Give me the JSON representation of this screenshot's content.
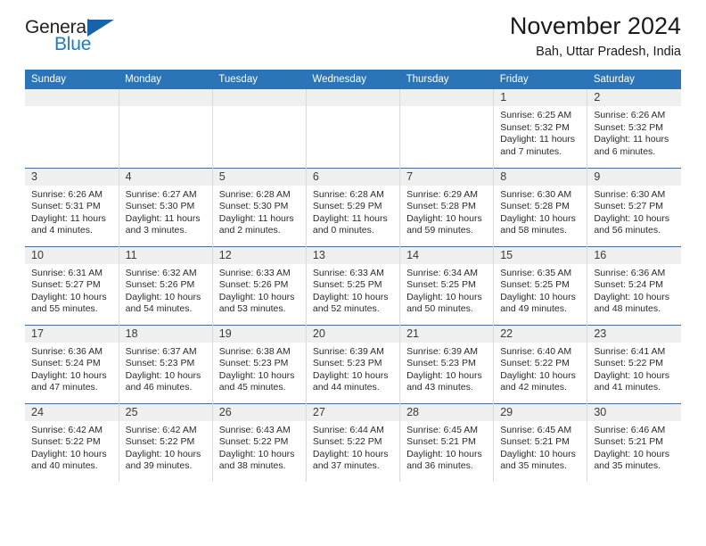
{
  "logo": {
    "word_top": "General",
    "word_bottom": "Blue",
    "triangle_color": "#1763ab",
    "blue_text_color": "#1f7ac4"
  },
  "header": {
    "title": "November 2024",
    "subtitle": "Bah, Uttar Pradesh, India",
    "accent_color": "#2b74b8"
  },
  "calendar": {
    "weekdays": [
      "Sunday",
      "Monday",
      "Tuesday",
      "Wednesday",
      "Thursday",
      "Friday",
      "Saturday"
    ],
    "weeks": [
      [
        {
          "day": "",
          "sunrise": "",
          "sunset": "",
          "daylight1": "",
          "daylight2": ""
        },
        {
          "day": "",
          "sunrise": "",
          "sunset": "",
          "daylight1": "",
          "daylight2": ""
        },
        {
          "day": "",
          "sunrise": "",
          "sunset": "",
          "daylight1": "",
          "daylight2": ""
        },
        {
          "day": "",
          "sunrise": "",
          "sunset": "",
          "daylight1": "",
          "daylight2": ""
        },
        {
          "day": "",
          "sunrise": "",
          "sunset": "",
          "daylight1": "",
          "daylight2": ""
        },
        {
          "day": "1",
          "sunrise": "Sunrise: 6:25 AM",
          "sunset": "Sunset: 5:32 PM",
          "daylight1": "Daylight: 11 hours",
          "daylight2": "and 7 minutes."
        },
        {
          "day": "2",
          "sunrise": "Sunrise: 6:26 AM",
          "sunset": "Sunset: 5:32 PM",
          "daylight1": "Daylight: 11 hours",
          "daylight2": "and 6 minutes."
        }
      ],
      [
        {
          "day": "3",
          "sunrise": "Sunrise: 6:26 AM",
          "sunset": "Sunset: 5:31 PM",
          "daylight1": "Daylight: 11 hours",
          "daylight2": "and 4 minutes."
        },
        {
          "day": "4",
          "sunrise": "Sunrise: 6:27 AM",
          "sunset": "Sunset: 5:30 PM",
          "daylight1": "Daylight: 11 hours",
          "daylight2": "and 3 minutes."
        },
        {
          "day": "5",
          "sunrise": "Sunrise: 6:28 AM",
          "sunset": "Sunset: 5:30 PM",
          "daylight1": "Daylight: 11 hours",
          "daylight2": "and 2 minutes."
        },
        {
          "day": "6",
          "sunrise": "Sunrise: 6:28 AM",
          "sunset": "Sunset: 5:29 PM",
          "daylight1": "Daylight: 11 hours",
          "daylight2": "and 0 minutes."
        },
        {
          "day": "7",
          "sunrise": "Sunrise: 6:29 AM",
          "sunset": "Sunset: 5:28 PM",
          "daylight1": "Daylight: 10 hours",
          "daylight2": "and 59 minutes."
        },
        {
          "day": "8",
          "sunrise": "Sunrise: 6:30 AM",
          "sunset": "Sunset: 5:28 PM",
          "daylight1": "Daylight: 10 hours",
          "daylight2": "and 58 minutes."
        },
        {
          "day": "9",
          "sunrise": "Sunrise: 6:30 AM",
          "sunset": "Sunset: 5:27 PM",
          "daylight1": "Daylight: 10 hours",
          "daylight2": "and 56 minutes."
        }
      ],
      [
        {
          "day": "10",
          "sunrise": "Sunrise: 6:31 AM",
          "sunset": "Sunset: 5:27 PM",
          "daylight1": "Daylight: 10 hours",
          "daylight2": "and 55 minutes."
        },
        {
          "day": "11",
          "sunrise": "Sunrise: 6:32 AM",
          "sunset": "Sunset: 5:26 PM",
          "daylight1": "Daylight: 10 hours",
          "daylight2": "and 54 minutes."
        },
        {
          "day": "12",
          "sunrise": "Sunrise: 6:33 AM",
          "sunset": "Sunset: 5:26 PM",
          "daylight1": "Daylight: 10 hours",
          "daylight2": "and 53 minutes."
        },
        {
          "day": "13",
          "sunrise": "Sunrise: 6:33 AM",
          "sunset": "Sunset: 5:25 PM",
          "daylight1": "Daylight: 10 hours",
          "daylight2": "and 52 minutes."
        },
        {
          "day": "14",
          "sunrise": "Sunrise: 6:34 AM",
          "sunset": "Sunset: 5:25 PM",
          "daylight1": "Daylight: 10 hours",
          "daylight2": "and 50 minutes."
        },
        {
          "day": "15",
          "sunrise": "Sunrise: 6:35 AM",
          "sunset": "Sunset: 5:25 PM",
          "daylight1": "Daylight: 10 hours",
          "daylight2": "and 49 minutes."
        },
        {
          "day": "16",
          "sunrise": "Sunrise: 6:36 AM",
          "sunset": "Sunset: 5:24 PM",
          "daylight1": "Daylight: 10 hours",
          "daylight2": "and 48 minutes."
        }
      ],
      [
        {
          "day": "17",
          "sunrise": "Sunrise: 6:36 AM",
          "sunset": "Sunset: 5:24 PM",
          "daylight1": "Daylight: 10 hours",
          "daylight2": "and 47 minutes."
        },
        {
          "day": "18",
          "sunrise": "Sunrise: 6:37 AM",
          "sunset": "Sunset: 5:23 PM",
          "daylight1": "Daylight: 10 hours",
          "daylight2": "and 46 minutes."
        },
        {
          "day": "19",
          "sunrise": "Sunrise: 6:38 AM",
          "sunset": "Sunset: 5:23 PM",
          "daylight1": "Daylight: 10 hours",
          "daylight2": "and 45 minutes."
        },
        {
          "day": "20",
          "sunrise": "Sunrise: 6:39 AM",
          "sunset": "Sunset: 5:23 PM",
          "daylight1": "Daylight: 10 hours",
          "daylight2": "and 44 minutes."
        },
        {
          "day": "21",
          "sunrise": "Sunrise: 6:39 AM",
          "sunset": "Sunset: 5:23 PM",
          "daylight1": "Daylight: 10 hours",
          "daylight2": "and 43 minutes."
        },
        {
          "day": "22",
          "sunrise": "Sunrise: 6:40 AM",
          "sunset": "Sunset: 5:22 PM",
          "daylight1": "Daylight: 10 hours",
          "daylight2": "and 42 minutes."
        },
        {
          "day": "23",
          "sunrise": "Sunrise: 6:41 AM",
          "sunset": "Sunset: 5:22 PM",
          "daylight1": "Daylight: 10 hours",
          "daylight2": "and 41 minutes."
        }
      ],
      [
        {
          "day": "24",
          "sunrise": "Sunrise: 6:42 AM",
          "sunset": "Sunset: 5:22 PM",
          "daylight1": "Daylight: 10 hours",
          "daylight2": "and 40 minutes."
        },
        {
          "day": "25",
          "sunrise": "Sunrise: 6:42 AM",
          "sunset": "Sunset: 5:22 PM",
          "daylight1": "Daylight: 10 hours",
          "daylight2": "and 39 minutes."
        },
        {
          "day": "26",
          "sunrise": "Sunrise: 6:43 AM",
          "sunset": "Sunset: 5:22 PM",
          "daylight1": "Daylight: 10 hours",
          "daylight2": "and 38 minutes."
        },
        {
          "day": "27",
          "sunrise": "Sunrise: 6:44 AM",
          "sunset": "Sunset: 5:22 PM",
          "daylight1": "Daylight: 10 hours",
          "daylight2": "and 37 minutes."
        },
        {
          "day": "28",
          "sunrise": "Sunrise: 6:45 AM",
          "sunset": "Sunset: 5:21 PM",
          "daylight1": "Daylight: 10 hours",
          "daylight2": "and 36 minutes."
        },
        {
          "day": "29",
          "sunrise": "Sunrise: 6:45 AM",
          "sunset": "Sunset: 5:21 PM",
          "daylight1": "Daylight: 10 hours",
          "daylight2": "and 35 minutes."
        },
        {
          "day": "30",
          "sunrise": "Sunrise: 6:46 AM",
          "sunset": "Sunset: 5:21 PM",
          "daylight1": "Daylight: 10 hours",
          "daylight2": "and 35 minutes."
        }
      ]
    ]
  }
}
